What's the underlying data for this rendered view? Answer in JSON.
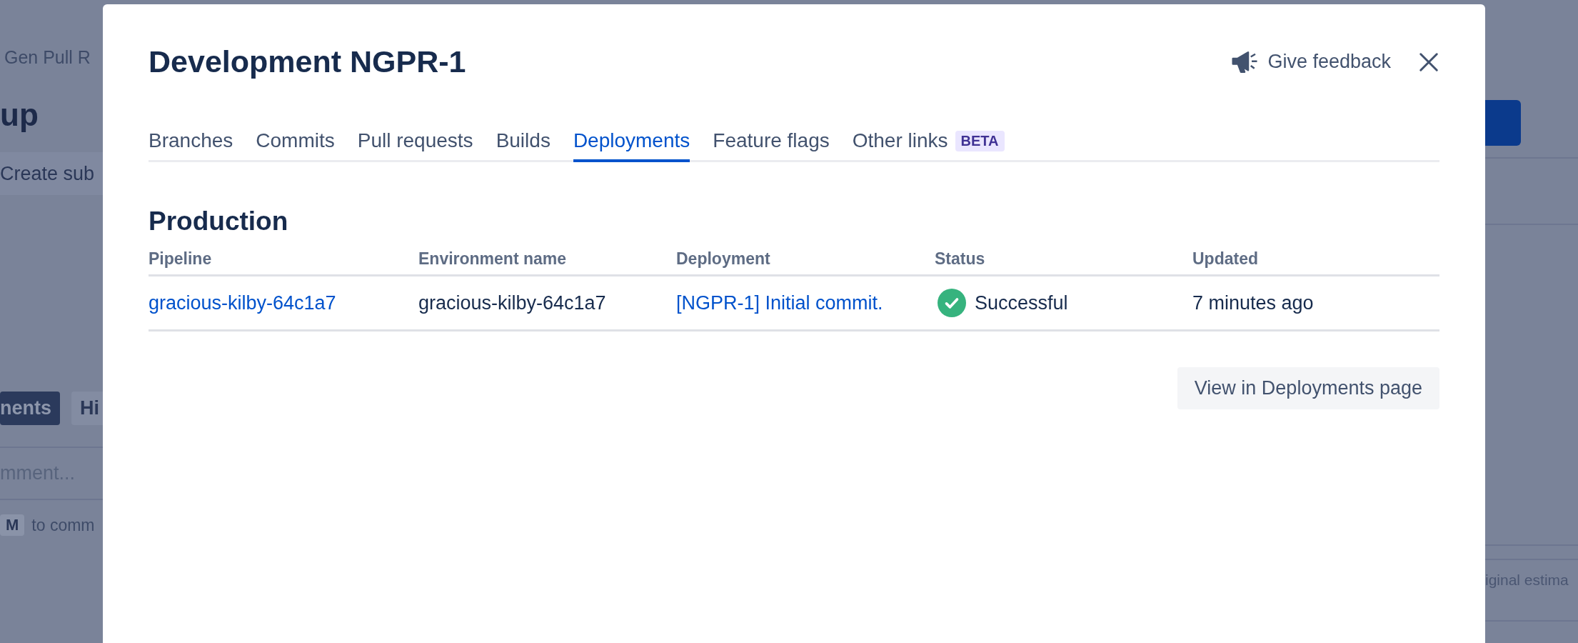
{
  "background": {
    "left": {
      "breadcrumb": "Gen Pull R",
      "heading": "up",
      "action": "Create sub",
      "activity_tabs": [
        {
          "label": "nents",
          "selected": true
        },
        {
          "label": "Hi",
          "selected": false
        }
      ],
      "comment_placeholder": "mment...",
      "shortcut_key": "M",
      "shortcut_hint": "to comm"
    },
    "right": {
      "field_label": "iginal estima"
    }
  },
  "modal": {
    "title": "Development NGPR-1",
    "feedback": "Give feedback",
    "tabs": [
      {
        "label": "Branches",
        "selected": false
      },
      {
        "label": "Commits",
        "selected": false
      },
      {
        "label": "Pull requests",
        "selected": false
      },
      {
        "label": "Builds",
        "selected": false
      },
      {
        "label": "Deployments",
        "selected": true
      },
      {
        "label": "Feature flags",
        "selected": false
      },
      {
        "label": "Other links",
        "selected": false,
        "badge": "BETA"
      }
    ],
    "section": "Production",
    "table": {
      "columns": [
        "Pipeline",
        "Environment name",
        "Deployment",
        "Status",
        "Updated"
      ],
      "rows": [
        {
          "pipeline": "gracious-kilby-64c1a7",
          "environment": "gracious-kilby-64c1a7",
          "deployment": "[NGPR-1] Initial commit.",
          "status": {
            "label": "Successful",
            "kind": "success"
          },
          "updated": "7 minutes ago"
        }
      ]
    },
    "button": "View in Deployments page"
  }
}
